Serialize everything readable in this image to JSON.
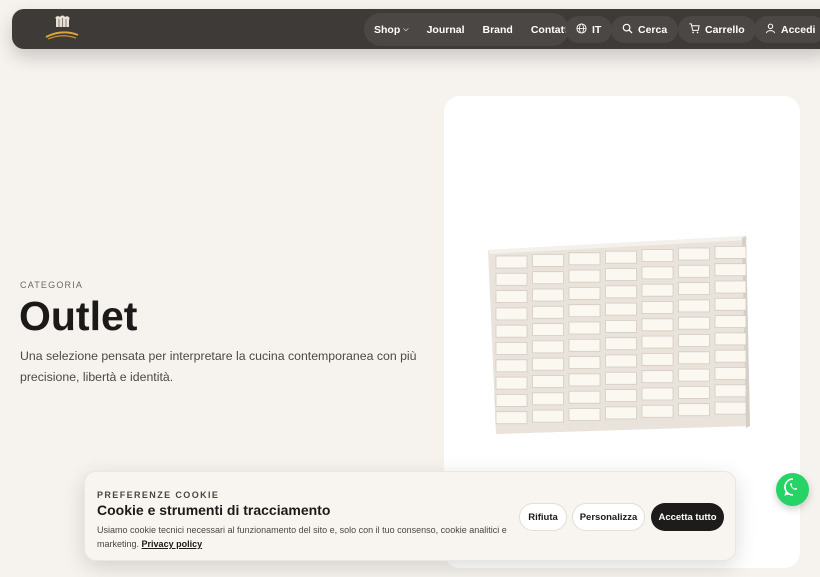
{
  "header": {
    "logo_icon": "chef-hat-logo",
    "nav": [
      {
        "label": "Shop",
        "has_dropdown": true
      },
      {
        "label": "Journal"
      },
      {
        "label": "Brand"
      },
      {
        "label": "Contatti"
      }
    ],
    "language": "IT",
    "search_label": "Cerca",
    "cart_label": "Carrello",
    "login_label": "Accedi"
  },
  "hero": {
    "eyebrow": "CATEGORIA",
    "title": "Outlet",
    "description": "Una selezione pensata per interpretare la cucina contemporanea con più precisione, libertà e identità."
  },
  "product": {
    "image_icon": "rectangular-mold-tray"
  },
  "cookie_banner": {
    "eyebrow": "PREFERENZE COOKIE",
    "title": "Cookie e strumenti di tracciamento",
    "text": "Usiamo cookie tecnici necessari al funzionamento del sito e, solo con il tuo consenso, cookie analitici e marketing.",
    "privacy_link": "Privacy policy",
    "reject_label": "Rifiuta",
    "customize_label": "Personalizza",
    "accept_label": "Accetta tutto"
  },
  "colors": {
    "background": "#f6f2ee",
    "header": "#3d3a38",
    "whatsapp": "#25d366",
    "accept_button": "#1e1c1b"
  }
}
